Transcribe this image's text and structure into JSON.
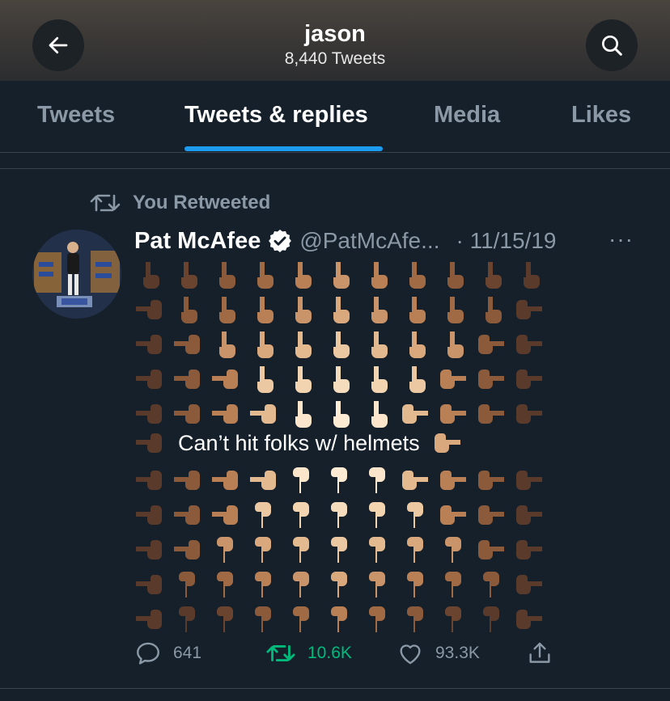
{
  "header": {
    "title": "jason",
    "subtitle": "8,440 Tweets"
  },
  "tabs": [
    {
      "label": "Tweets"
    },
    {
      "label": "Tweets & replies",
      "active": true
    },
    {
      "label": "Media"
    },
    {
      "label": "Likes"
    }
  ],
  "tweet": {
    "retweet_label": "You Retweeted",
    "author_name": "Pat McAfee",
    "handle": "@PatMcAfe...",
    "date": "· 11/15/19",
    "more": "···",
    "text": "Can’t hit folks w/ helmets",
    "stats": {
      "replies": "641",
      "retweets": "10.6K",
      "likes": "93.3K"
    }
  },
  "colors": {
    "background": "#15202b",
    "accent": "#1d9bf0",
    "retweet_green": "#00ba7c",
    "muted": "#8b98a5"
  },
  "icons": [
    "back-arrow-icon",
    "search-icon",
    "retweet-icon",
    "verified-badge-icon",
    "reply-icon",
    "like-icon",
    "share-icon",
    "pointing-hand-emoji"
  ]
}
